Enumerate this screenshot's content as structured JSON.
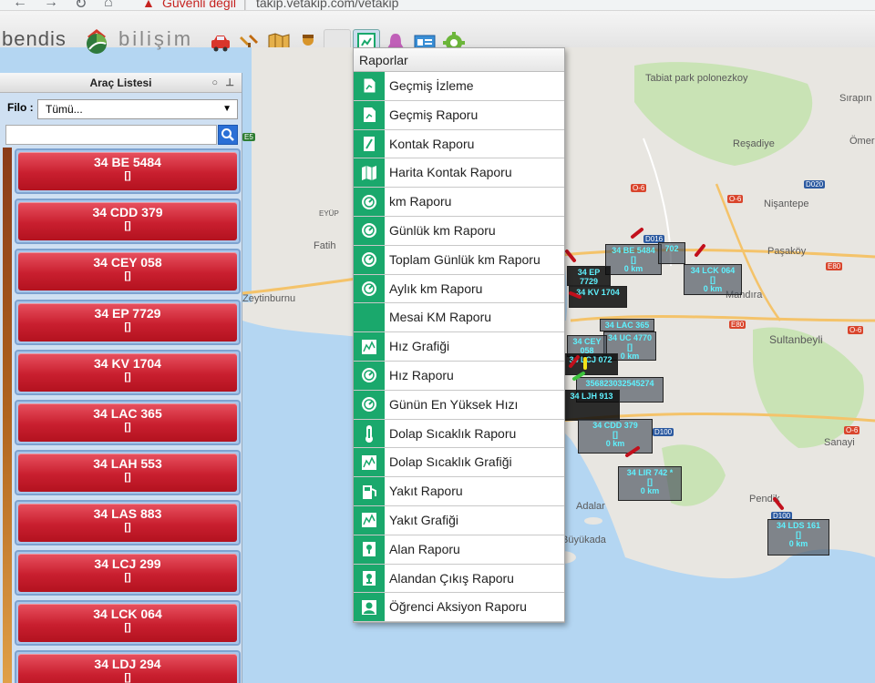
{
  "browser": {
    "security_label": "Güvenli değil",
    "separator": "|",
    "url": "takip.vetakip.com/vetakip"
  },
  "logo": {
    "part1": "bendis",
    "part2": "bilişim"
  },
  "toolbar": {
    "icons": [
      "car-icon",
      "tools-icon",
      "map-icon",
      "user-icon",
      "blank-icon",
      "reports-icon",
      "alarm-bell-icon",
      "id-card-icon",
      "settings-gear-icon"
    ]
  },
  "side_panel": {
    "title": "Araç Listesi",
    "filo_label": "Filo :",
    "filo_value": "Tümü...",
    "search_value": "",
    "vehicles": [
      {
        "plate": "34 BE 5484",
        "sub": "[]"
      },
      {
        "plate": "34 CDD 379",
        "sub": "[]"
      },
      {
        "plate": "34 CEY 058",
        "sub": "[]"
      },
      {
        "plate": "34 EP 7729",
        "sub": "[]"
      },
      {
        "plate": "34 KV 1704",
        "sub": "[]"
      },
      {
        "plate": "34 LAC 365",
        "sub": "[]"
      },
      {
        "plate": "34 LAH 553",
        "sub": "[]"
      },
      {
        "plate": "34 LAS 883",
        "sub": "[]"
      },
      {
        "plate": "34 LCJ 299",
        "sub": "[]"
      },
      {
        "plate": "34 LCK 064",
        "sub": "[]"
      },
      {
        "plate": "34 LDJ 294",
        "sub": "[]"
      }
    ]
  },
  "menu": {
    "title": "Raporlar",
    "items": [
      {
        "label": "Geçmiş İzleme",
        "icon": "history-track-icon"
      },
      {
        "label": "Geçmiş Raporu",
        "icon": "history-report-icon"
      },
      {
        "label": "Kontak Raporu",
        "icon": "ignition-report-icon"
      },
      {
        "label": "Harita Kontak Raporu",
        "icon": "map-ignition-icon"
      },
      {
        "label": "km Raporu",
        "icon": "gauge-icon"
      },
      {
        "label": "Günlük km Raporu",
        "icon": "gauge-icon"
      },
      {
        "label": "Toplam Günlük km Raporu",
        "icon": "gauge-icon"
      },
      {
        "label": "Aylık km Raporu",
        "icon": "gauge-icon"
      },
      {
        "label": "Mesai KM Raporu",
        "icon": "blank-icon"
      },
      {
        "label": "Hız Grafiği",
        "icon": "line-chart-icon"
      },
      {
        "label": "Hız Raporu",
        "icon": "gauge-icon"
      },
      {
        "label": "Günün En Yüksek Hızı",
        "icon": "gauge-icon"
      },
      {
        "label": "Dolap Sıcaklık Raporu",
        "icon": "thermometer-icon"
      },
      {
        "label": "Dolap Sıcaklık Grafiği",
        "icon": "line-chart-icon"
      },
      {
        "label": "Yakıt Raporu",
        "icon": "fuel-pump-icon"
      },
      {
        "label": "Yakıt Grafiği",
        "icon": "line-chart-icon"
      },
      {
        "label": "Alan Raporu",
        "icon": "area-icon"
      },
      {
        "label": "Alandan Çıkış Raporu",
        "icon": "area-exit-icon"
      },
      {
        "label": "Öğrenci Aksiyon Raporu",
        "icon": "student-icon"
      }
    ]
  },
  "map": {
    "places": [
      "Tabiat park polonezkoy",
      "Sırapın",
      "Reşadiye",
      "Ömer",
      "Nişantepe",
      "Paşaköy",
      "Fatih",
      "EYÜP",
      "Zeytinburnu",
      "Sultanbeyli",
      "Sanayi",
      "Adalar",
      "Büyükada",
      "Pendik",
      "Mandıra"
    ],
    "road_labels": [
      "D016",
      "D020",
      "O-6",
      "O-6",
      "O-6",
      "E80",
      "E80",
      "D100",
      "O-6",
      "D100",
      "E5"
    ],
    "markers": [
      {
        "line1": "34 BE 5484",
        "line2": "[]",
        "line3": "0 km"
      },
      {
        "line1": "702",
        "line2": "",
        "line3": ""
      },
      {
        "line1": "34 LCK 064",
        "line2": "[]",
        "line3": "0 km"
      },
      {
        "line1": "34 KV 1704",
        "line2": "",
        "line3": ""
      },
      {
        "line1": "34 LAC 365",
        "line2": "",
        "line3": ""
      },
      {
        "line1": "34 UC 4770",
        "line2": "[]",
        "line3": "0 km"
      },
      {
        "line1": "34 CEY 058",
        "line2": "",
        "line3": ""
      },
      {
        "line1": "34 LCJ 072",
        "line2": "",
        "line3": ""
      },
      {
        "line1": "356823032545274",
        "line2": "",
        "line3": ""
      },
      {
        "line1": "34 LJH 913",
        "line2": "",
        "line3": ""
      },
      {
        "line1": "34 CDD 379",
        "line2": "[]",
        "line3": "0 km"
      },
      {
        "line1": "34 LIR 742 *",
        "line2": "[]",
        "line3": "0 km"
      },
      {
        "line1": "34 LDS 161",
        "line2": "[]",
        "line3": "0 km"
      },
      {
        "line1": "34 EP 7729",
        "line2": "",
        "line3": ""
      }
    ]
  },
  "colors": {
    "menu_icon_bg": "#1aa86c",
    "vehicle_red": "#c91f2f",
    "sea": "#b4d6f2",
    "land": "#e8e6e1",
    "green_area": "#c9e3b5",
    "marker_text": "#5ff2ff"
  }
}
